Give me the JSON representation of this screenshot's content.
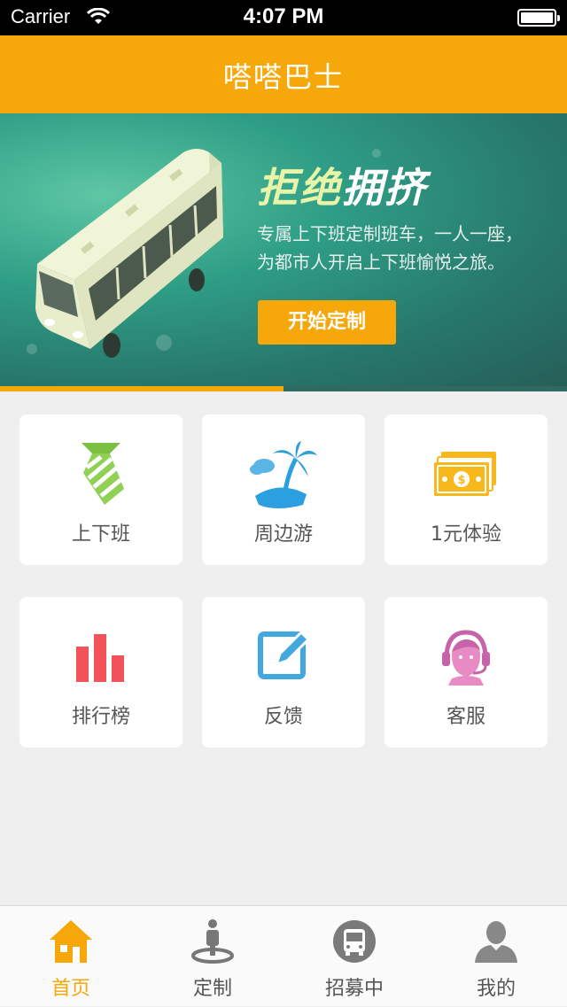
{
  "status_bar": {
    "carrier": "Carrier",
    "time": "4:07 PM"
  },
  "nav": {
    "title": "嗒嗒巴士"
  },
  "banner": {
    "headline_a": "拒绝",
    "headline_b": "拥挤",
    "desc_line1": "专属上下班定制班车，一人一座，",
    "desc_line2": "为都市人开启上下班愉悦之旅。",
    "cta_label": "开始定制",
    "carousel_active_index": 0,
    "carousel_count": 2
  },
  "tiles": [
    {
      "label": "上下班",
      "icon": "tie-icon"
    },
    {
      "label": "周边游",
      "icon": "island-icon"
    },
    {
      "label": "1元体验",
      "icon": "money-icon"
    },
    {
      "label": "排行榜",
      "icon": "bar-chart-icon"
    },
    {
      "label": "反馈",
      "icon": "edit-icon"
    },
    {
      "label": "客服",
      "icon": "headset-icon"
    }
  ],
  "tabs": [
    {
      "label": "首页",
      "icon": "home-icon",
      "active": true
    },
    {
      "label": "定制",
      "icon": "location-person-icon",
      "active": false
    },
    {
      "label": "招募中",
      "icon": "bus-icon",
      "active": false
    },
    {
      "label": "我的",
      "icon": "user-icon",
      "active": false
    }
  ],
  "colors": {
    "accent": "#f6a70a",
    "banner": "#2f8f7c",
    "background": "#efefef"
  }
}
